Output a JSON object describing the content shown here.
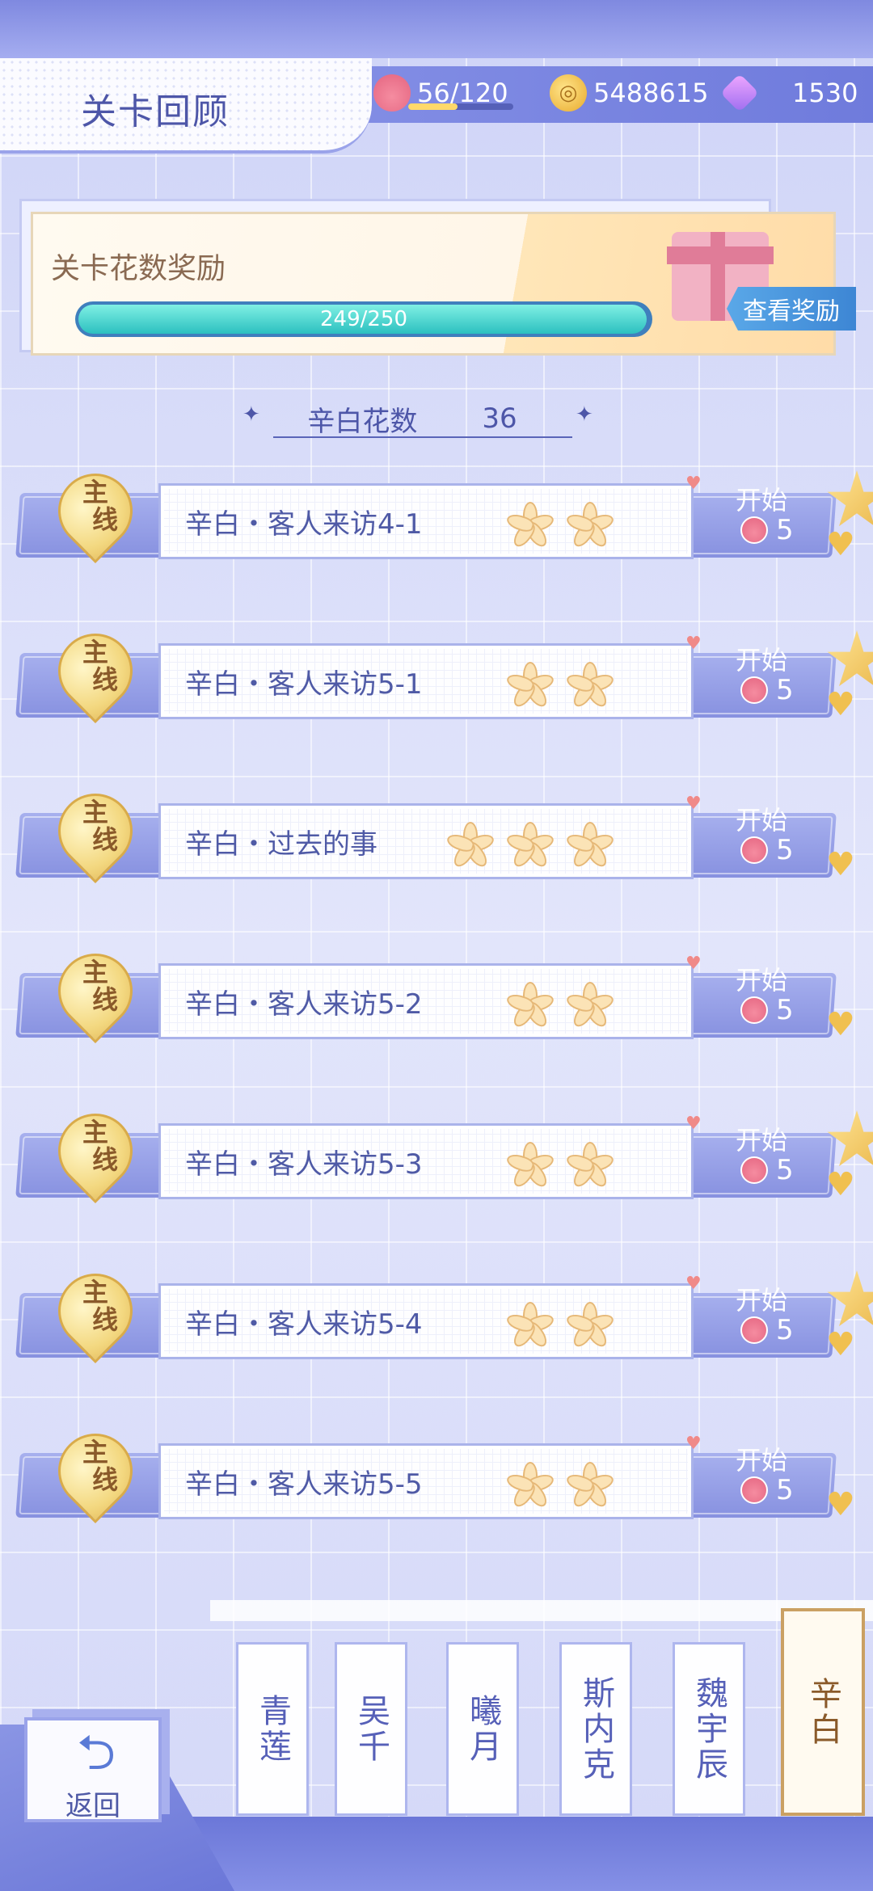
{
  "header": {
    "title": "关卡回顾",
    "stamina": "56/120",
    "stamina_fraction": 0.47,
    "coins": "5488615",
    "gems": "1530"
  },
  "reward": {
    "title": "关卡花数奖励",
    "progress_text": "249/250",
    "progress_fraction": 0.996,
    "view_button": "查看奖励"
  },
  "score": {
    "label": "辛白花数",
    "value": "36"
  },
  "levels": [
    {
      "tag_line1": "主",
      "tag_line2": "线",
      "name": "辛白・客人来访4-1",
      "flowers": 2,
      "start": "开始",
      "cost": "5",
      "star_badge": true
    },
    {
      "tag_line1": "主",
      "tag_line2": "线",
      "name": "辛白・客人来访5-1",
      "flowers": 2,
      "start": "开始",
      "cost": "5",
      "star_badge": true
    },
    {
      "tag_line1": "主",
      "tag_line2": "线",
      "name": "辛白・过去的事",
      "flowers": 3,
      "start": "开始",
      "cost": "5",
      "star_badge": false
    },
    {
      "tag_line1": "主",
      "tag_line2": "线",
      "name": "辛白・客人来访5-2",
      "flowers": 2,
      "start": "开始",
      "cost": "5",
      "star_badge": false
    },
    {
      "tag_line1": "主",
      "tag_line2": "线",
      "name": "辛白・客人来访5-3",
      "flowers": 2,
      "start": "开始",
      "cost": "5",
      "star_badge": true
    },
    {
      "tag_line1": "主",
      "tag_line2": "线",
      "name": "辛白・客人来访5-4",
      "flowers": 2,
      "start": "开始",
      "cost": "5",
      "star_badge": true
    },
    {
      "tag_line1": "主",
      "tag_line2": "线",
      "name": "辛白・客人来访5-5",
      "flowers": 2,
      "start": "开始",
      "cost": "5",
      "star_badge": false
    }
  ],
  "tabs": [
    {
      "label": "青莲",
      "active": false
    },
    {
      "label": "吴千",
      "active": false
    },
    {
      "label": "曦月",
      "active": false
    },
    {
      "label": "斯内克",
      "active": false
    },
    {
      "label": "魏宇辰",
      "active": false
    },
    {
      "label": "辛白",
      "active": true
    }
  ],
  "back_button": "返回",
  "icons": {
    "stamina": "cake-icon",
    "coins": "coin-icon",
    "gems": "gem-icon",
    "back": "return-arrow-icon",
    "flower": "flower-icon",
    "start_cost": "cake-icon",
    "badge": "star-badge-icon",
    "heart": "heart-icon"
  },
  "colors": {
    "accent": "#4d56a8",
    "header_bar": "#7f89e0",
    "progress": "#2cc0c0",
    "flower": "#fbe3b6",
    "active_tab_border": "#caa063"
  }
}
